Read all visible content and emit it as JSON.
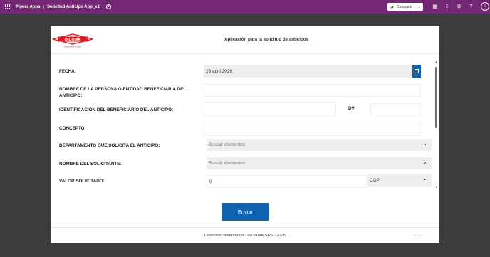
{
  "topbar": {
    "brand": "Power Apps",
    "separator": "|",
    "app_name": "Solicitud Anticipo App_v1",
    "share_label": "Compartir",
    "icons": [
      "waffle-icon",
      "info-icon",
      "share-icon",
      "chevron-down-icon",
      "grid-icon",
      "download-icon",
      "settings-icon",
      "help-icon",
      "avatar-icon"
    ],
    "avatar_initial": "i"
  },
  "colors": {
    "topbar": "#742774",
    "primary": "#0f62ad",
    "logo_red": "#d81f26"
  },
  "header": {
    "logo_text": "INDUMA",
    "logo_tagline": "Bienvenido a su Casa",
    "title": "Aplicación para la solicitud de anticipos"
  },
  "form": {
    "fecha_label": "FECHA:",
    "fecha_value": "28 abril 2026",
    "beneficiario_label_1": "NOMBRE DE LA PERSONA O ENTIDAD BENEFICIARIA DEL",
    "beneficiario_label_2": "ANTICIPO:",
    "identificacion_label": "IDENTIFICACIÓN DEL BENEFICIARIO DEL ANTICIPO:",
    "dv_label": "DV",
    "concepto_label": "CONCEPTO:",
    "departamento_label": "DEPARTAMENTO QUE SOLICITA EL ANTICIPO:",
    "departamento_placeholder": "Buscar elementos",
    "solicitante_label": "NOMBRE DEL SOLICITANTE:",
    "solicitante_placeholder": "Buscar elementos",
    "valor_label": "VALOR SOLICITADO:",
    "valor_value": "0",
    "moneda_value": "COP"
  },
  "actions": {
    "send_label": "Enviar"
  },
  "footer": {
    "text": "Derechos reservados - INDUMA SAS - 2025",
    "version": "v 1.0"
  }
}
